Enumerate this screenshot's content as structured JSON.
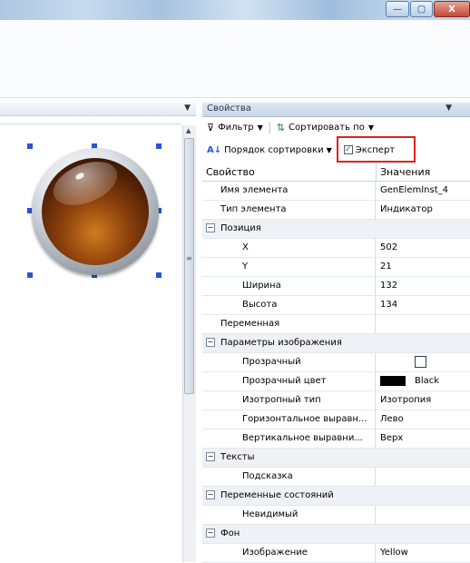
{
  "window": {
    "minimize_symbol": "—",
    "restore_symbol": "▢",
    "close_symbol": "X"
  },
  "properties_panel": {
    "title": "Свойства",
    "toolbar": {
      "filter_label": "Фильтр",
      "sort_by_label": "Сортировать по",
      "sort_order_label": "Порядок сортировки",
      "expert_label": "Эксперт",
      "expert_checked": true
    },
    "columns": {
      "property": "Свойство",
      "values": "Значения"
    },
    "rows": [
      {
        "type": "prop",
        "name": "Имя элемента",
        "value": "GenElemInst_4",
        "indent": 1
      },
      {
        "type": "prop",
        "name": "Тип элемента",
        "value": "Индикатор",
        "indent": 1
      },
      {
        "type": "cat",
        "name": "Позиция",
        "collapse_symbol": "⊟"
      },
      {
        "type": "prop",
        "name": "X",
        "value": "502",
        "indent": 2
      },
      {
        "type": "prop",
        "name": "Y",
        "value": "21",
        "indent": 2
      },
      {
        "type": "prop",
        "name": "Ширина",
        "value": "132",
        "indent": 2
      },
      {
        "type": "prop",
        "name": "Высота",
        "value": "134",
        "indent": 2
      },
      {
        "type": "prop",
        "name": "Переменная",
        "value": "",
        "indent": 1
      },
      {
        "type": "cat",
        "name": "Параметры изображения",
        "collapse_symbol": "⊟"
      },
      {
        "type": "check",
        "name": "Прозрачный",
        "value": "",
        "indent": 2,
        "checked": false
      },
      {
        "type": "color",
        "name": "Прозрачный цвет",
        "value": "Black",
        "indent": 2,
        "color": "#000000"
      },
      {
        "type": "prop",
        "name": "Изотропный тип",
        "value": "Изотропия",
        "indent": 2
      },
      {
        "type": "prop",
        "name": "Горизонтальное выравн...",
        "value": "Лево",
        "indent": 2
      },
      {
        "type": "prop",
        "name": "Вертикальное выравни...",
        "value": "Верх",
        "indent": 2
      },
      {
        "type": "cat",
        "name": "Тексты",
        "collapse_symbol": "⊟"
      },
      {
        "type": "prop",
        "name": "Подсказка",
        "value": "",
        "indent": 2
      },
      {
        "type": "cat",
        "name": "Переменные состояний",
        "collapse_symbol": "⊟"
      },
      {
        "type": "prop",
        "name": "Невидимый",
        "value": "",
        "indent": 2
      },
      {
        "type": "cat",
        "name": "Фон",
        "collapse_symbol": "⊟"
      },
      {
        "type": "prop",
        "name": "Изображение",
        "value": "Yellow",
        "indent": 2
      }
    ]
  },
  "colors": {
    "highlight_box": "#e02020",
    "selection_handle": "#2a52d6"
  }
}
